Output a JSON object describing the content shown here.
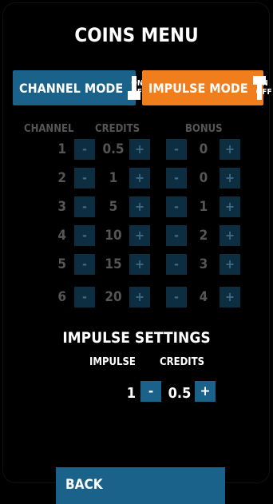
{
  "title": "COINS MENU",
  "modes": {
    "channel": {
      "label": "CHANNEL MODE",
      "on": "ON",
      "off": "OFF"
    },
    "impulse": {
      "label": "IMPULSE MODE",
      "on": "ON",
      "off": "OFF"
    }
  },
  "table": {
    "headers": {
      "channel": "CHANNEL",
      "credits": "CREDITS",
      "bonus": "BONUS"
    },
    "minus": "-",
    "plus": "+",
    "rows": [
      {
        "channel": "1",
        "credits": "0.5",
        "bonus": "0"
      },
      {
        "channel": "2",
        "credits": "1",
        "bonus": "0"
      },
      {
        "channel": "3",
        "credits": "5",
        "bonus": "1"
      },
      {
        "channel": "4",
        "credits": "10",
        "bonus": "2"
      },
      {
        "channel": "5",
        "credits": "15",
        "bonus": "3"
      },
      {
        "channel": "6",
        "credits": "20",
        "bonus": "4"
      }
    ]
  },
  "impulse_settings": {
    "title": "IMPULSE SETTINGS",
    "impulse_label": "IMPULSE",
    "credits_label": "CREDITS",
    "impulse_value": "1",
    "credits_value": "0.5",
    "minus": "-",
    "plus": "+"
  },
  "back_label": "BACK",
  "colors": {
    "background": "#000000",
    "channel_mode": "#1a6289",
    "impulse_mode": "#f07e1d",
    "disabled_button": "#0d2e40",
    "disabled_text": "#555555"
  }
}
